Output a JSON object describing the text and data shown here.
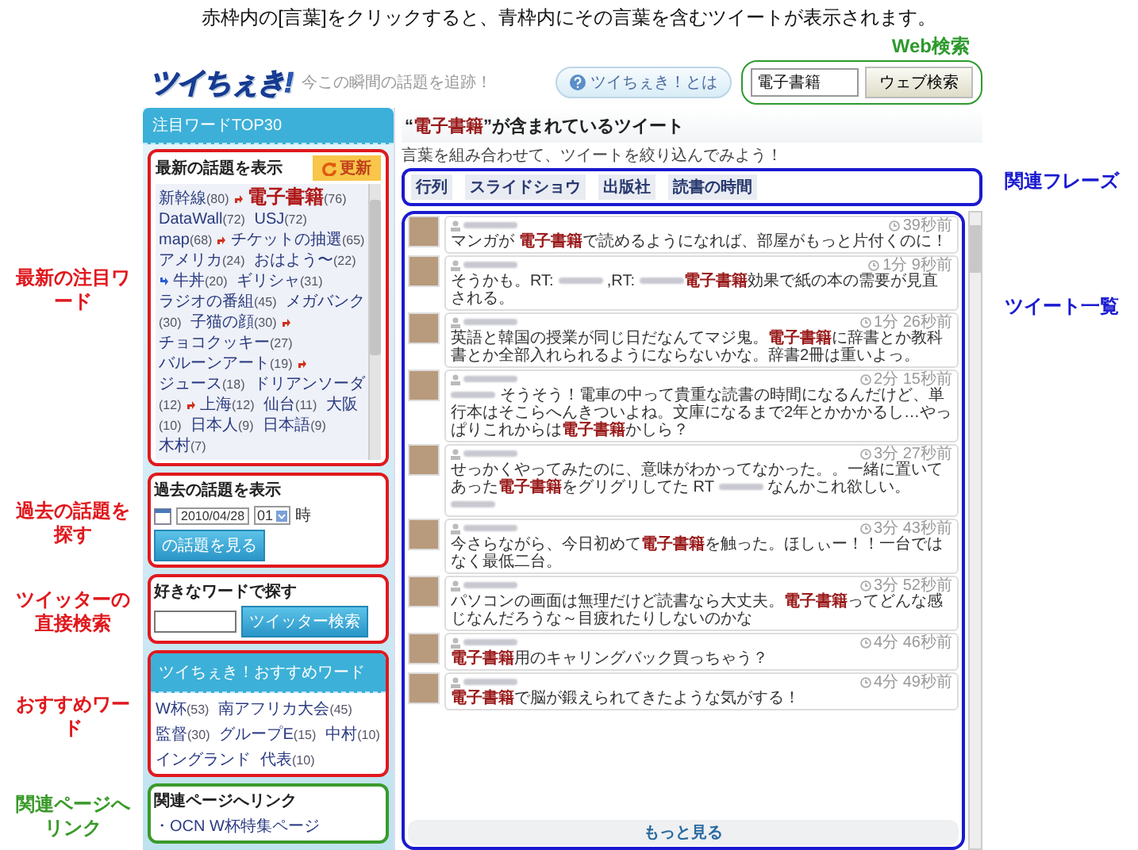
{
  "annotations": {
    "top": "赤枠内の[言葉]をクリックすると、青枠内にその言葉を含むツイートが表示されます。",
    "web_search": {
      "text": "Web検索",
      "color": "#2e9a2e"
    },
    "left": [
      {
        "text": "最新の注目ワード",
        "color": "#e0191e"
      },
      {
        "text": "過去の話題を探す",
        "color": "#e0191e"
      },
      {
        "text": "ツイッターの直接検索",
        "color": "#e0191e"
      },
      {
        "text": "おすすめワード",
        "color": "#e0191e"
      },
      {
        "text": "関連ページへリンク",
        "color": "#3a9a2a"
      }
    ],
    "right": [
      {
        "text": "関連フレーズ",
        "color": "#1a1ad0"
      },
      {
        "text": "ツイート一覧",
        "color": "#1a1ad0"
      }
    ]
  },
  "header": {
    "logo": "ツイちぇき!",
    "tagline": "今この瞬間の話題を追跡！",
    "about": "ツイちぇき！とは",
    "search_value": "電子書籍",
    "search_button": "ウェブ検索"
  },
  "sidebar": {
    "top_words": {
      "title": "注目ワードTOP30",
      "box_title": "最新の話題を表示",
      "refresh": "更新",
      "words": [
        {
          "word": "新幹線",
          "count": "(80)",
          "kind": "rising",
          "featured": false
        },
        {
          "word": "電子書籍",
          "count": "(76)",
          "kind": "plain",
          "featured": true
        },
        {
          "word": "DataWall",
          "count": "(72)",
          "kind": "plain",
          "featured": false
        },
        {
          "word": "USJ",
          "count": "(72)",
          "kind": "plain",
          "featured": false
        },
        {
          "word": "map",
          "count": "(68)",
          "kind": "rising",
          "featured": false
        },
        {
          "word": "チケットの抽選",
          "count": "(65)",
          "kind": "plain",
          "featured": false
        },
        {
          "word": "アメリカ",
          "count": "(24)",
          "kind": "plain",
          "featured": false
        },
        {
          "word": "おはよう〜",
          "count": "(22)",
          "kind": "falling",
          "featured": false
        },
        {
          "word": "牛丼",
          "count": "(20)",
          "kind": "plain",
          "featured": false
        },
        {
          "word": "ギリシャ",
          "count": "(31)",
          "kind": "plain",
          "featured": false
        },
        {
          "word": "ラジオの番組",
          "count": "(45)",
          "kind": "plain",
          "featured": false
        },
        {
          "word": "メガバンク",
          "count": "(30)",
          "kind": "plain",
          "featured": false
        },
        {
          "word": "子猫の顔",
          "count": "(30)",
          "kind": "rising",
          "featured": false
        },
        {
          "word": "チョコクッキー",
          "count": "(27)",
          "kind": "plain",
          "featured": false
        },
        {
          "word": "バルーンアート",
          "count": "(19)",
          "kind": "rising",
          "featured": false
        },
        {
          "word": "ジュース",
          "count": "(18)",
          "kind": "plain",
          "featured": false
        },
        {
          "word": "ドリアンソーダ",
          "count": "(12)",
          "kind": "rising",
          "featured": false
        },
        {
          "word": "上海",
          "count": "(12)",
          "kind": "plain",
          "featured": false
        },
        {
          "word": "仙台",
          "count": "(11)",
          "kind": "plain",
          "featured": false
        },
        {
          "word": "大阪",
          "count": "(10)",
          "kind": "plain",
          "featured": false
        },
        {
          "word": "日本人",
          "count": "(9)",
          "kind": "plain",
          "featured": false
        },
        {
          "word": "日本語",
          "count": "(9)",
          "kind": "plain",
          "featured": false
        },
        {
          "word": "木村",
          "count": "(7)",
          "kind": "plain",
          "featured": false
        }
      ]
    },
    "past": {
      "title": "過去の話題を表示",
      "date": "2010/04/28",
      "hour": "01",
      "hour_unit": "時",
      "button": "の話題を見る"
    },
    "search": {
      "title": "好きなワードで探す",
      "button": "ツイッター検索"
    },
    "recommend": {
      "title": "ツイちぇき！おすすめワード",
      "words": [
        {
          "word": "W杯",
          "count": "(53)"
        },
        {
          "word": "南アフリカ大会",
          "count": "(45)"
        },
        {
          "word": "監督",
          "count": "(30)"
        },
        {
          "word": "グループE",
          "count": "(15)"
        },
        {
          "word": "中村",
          "count": "(10)"
        },
        {
          "word": "イングランド"
        },
        {
          "word": "代表",
          "count": "(10)"
        }
      ]
    },
    "links": {
      "title": "関連ページへリンク",
      "items": [
        "・OCN W杯特集ページ"
      ]
    }
  },
  "main": {
    "title": "“**電子書籍**”が含まれているツイート",
    "subtitle": "言葉を組み合わせて、ツイートを絞り込んでみよう！",
    "phrases": [
      "行列",
      "スライドショウ",
      "出版社",
      "読書の時間"
    ],
    "tweets": [
      {
        "time": "39秒前",
        "parts": [
          {
            "kind": "text",
            "text": "マンガが "
          },
          {
            "kind": "keyword",
            "text": "電子書籍"
          },
          {
            "kind": "text",
            "text": "で読めるようになれば、部屋がもっと片付くのに！"
          }
        ]
      },
      {
        "time": "1分 9秒前",
        "parts": [
          {
            "kind": "text",
            "text": "そうかも。RT: "
          },
          {
            "kind": "blurred"
          },
          {
            "kind": "text",
            "text": " ,RT: "
          },
          {
            "kind": "blurred"
          },
          {
            "kind": "keyword",
            "text": "電子書籍"
          },
          {
            "kind": "text",
            "text": "効果で紙の本の需要が見直される。"
          }
        ]
      },
      {
        "time": "1分 26秒前",
        "parts": [
          {
            "kind": "text",
            "text": "英語と韓国の授業が同じ日だなんてマジ鬼。"
          },
          {
            "kind": "keyword",
            "text": "電子書籍"
          },
          {
            "kind": "text",
            "text": "に辞書とか教科書とか全部入れられるようにならないかな。辞書2冊は重いよっ。"
          }
        ]
      },
      {
        "time": "2分 15秒前",
        "parts": [
          {
            "kind": "blurred"
          },
          {
            "kind": "text",
            "text": " そうそう！電車の中って貴重な読書の時間になるんだけど、単行本はそこらへんきついよね。文庫になるまで2年とかかかるし…やっぱりこれからは"
          },
          {
            "kind": "keyword",
            "text": "電子書籍"
          },
          {
            "kind": "text",
            "text": "かしら？"
          }
        ]
      },
      {
        "time": "3分 27秒前",
        "parts": [
          {
            "kind": "text",
            "text": "せっかくやってみたのに、意味がわかってなかった。。一緒に置いてあった"
          },
          {
            "kind": "keyword",
            "text": "電子書籍"
          },
          {
            "kind": "text",
            "text": "をグリグリしてた RT "
          },
          {
            "kind": "blurred"
          },
          {
            "kind": "text",
            "text": " なんかこれ欲しい。"
          },
          {
            "kind": "blurred"
          }
        ]
      },
      {
        "time": "3分 43秒前",
        "parts": [
          {
            "kind": "text",
            "text": "今さらながら、今日初めて"
          },
          {
            "kind": "keyword",
            "text": "電子書籍"
          },
          {
            "kind": "text",
            "text": "を触った。ほしぃー！！一台ではなく最低二台。"
          }
        ]
      },
      {
        "time": "3分 52秒前",
        "parts": [
          {
            "kind": "text",
            "text": "パソコンの画面は無理だけど読書なら大丈夫。"
          },
          {
            "kind": "keyword",
            "text": "電子書籍"
          },
          {
            "kind": "text",
            "text": "ってどんな感じなんだろうな～目疲れたりしないのかな"
          }
        ]
      },
      {
        "time": "4分 46秒前",
        "parts": [
          {
            "kind": "keyword",
            "text": "電子書籍"
          },
          {
            "kind": "text",
            "text": "用のキャリングバック買っちゃう？"
          }
        ]
      },
      {
        "time": "4分 49秒前",
        "parts": [
          {
            "kind": "keyword",
            "text": "電子書籍"
          },
          {
            "kind": "text",
            "text": "で脳が鍛えられてきたような気がする！"
          }
        ]
      }
    ],
    "more": "もっと見る"
  }
}
